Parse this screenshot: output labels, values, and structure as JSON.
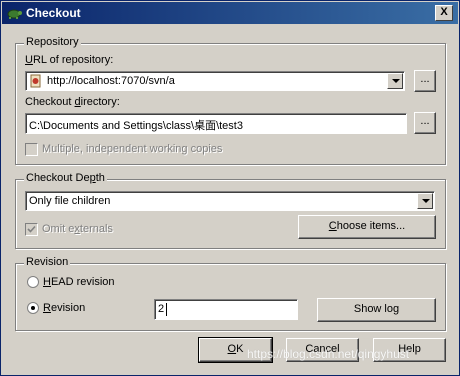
{
  "window": {
    "title": "Checkout",
    "close_label": "X"
  },
  "repository": {
    "legend": "Repository",
    "url_label_pre": "",
    "url_label_u": "U",
    "url_label_post": "RL of repository:",
    "url_value": "http://localhost:7070/svn/a",
    "browse_label": "...",
    "dir_label_pre": "Checkout ",
    "dir_label_u": "d",
    "dir_label_post": "irectory:",
    "dir_value": "C:\\Documents and Settings\\class\\桌面\\test3",
    "browse2_label": "...",
    "multiple_label": "Multiple, independent working copies",
    "multiple_checked": false
  },
  "depth": {
    "legend_pre": "Checkout De",
    "legend_u": "p",
    "legend_post": "th",
    "selected": "Only file children",
    "omit_pre": "Omit e",
    "omit_u": "x",
    "omit_post": "ternals",
    "omit_checked": true,
    "choose_pre": "",
    "choose_u": "C",
    "choose_post": "hoose items..."
  },
  "revision": {
    "legend": "Revision",
    "head_pre": "",
    "head_u": "H",
    "head_post": "EAD revision",
    "rev_pre": "",
    "rev_u": "R",
    "rev_post": "evision",
    "selected": "revision",
    "rev_value": "2",
    "showlog_label": "Show log"
  },
  "buttons": {
    "ok_pre": "",
    "ok_u": "O",
    "ok_post": "K",
    "cancel_label": "Cancel",
    "help_label": "Help"
  },
  "watermark": "https://blog.csdn.net/qingyhust"
}
